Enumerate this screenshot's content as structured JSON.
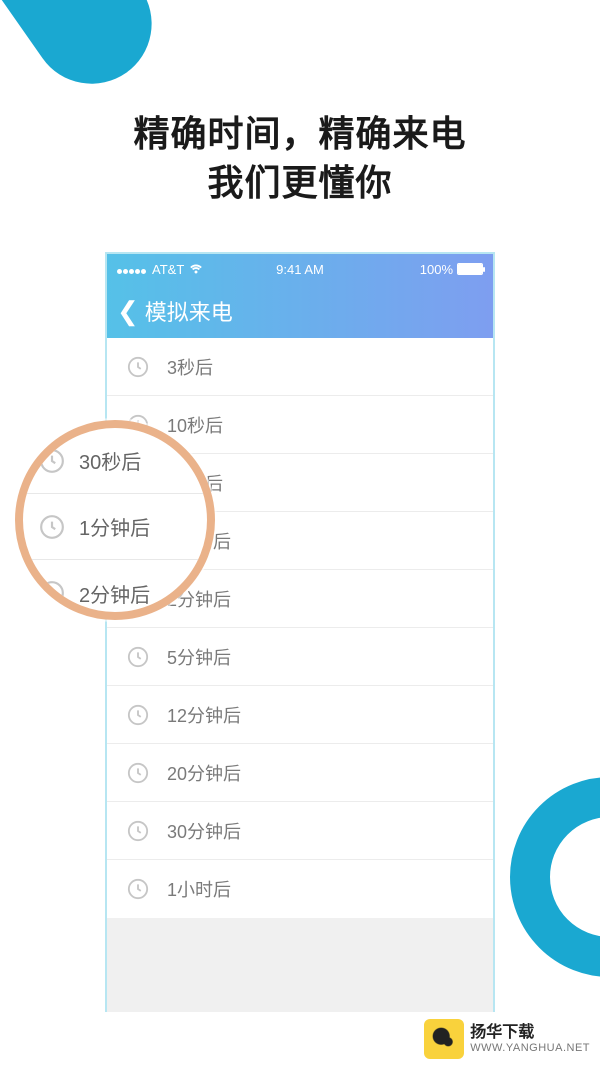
{
  "headline": {
    "line1": "精确时间，精确来电",
    "line2": "我们更懂你"
  },
  "status": {
    "carrier": "AT&T",
    "time": "9:41 AM",
    "battery": "100%"
  },
  "nav": {
    "title": "模拟来电"
  },
  "list": {
    "items": [
      {
        "label": "3秒后"
      },
      {
        "label": "10秒后"
      },
      {
        "label": "30秒后"
      },
      {
        "label": "1分钟后"
      },
      {
        "label": "2分钟后"
      },
      {
        "label": "5分钟后"
      },
      {
        "label": "12分钟后"
      },
      {
        "label": "20分钟后"
      },
      {
        "label": "30分钟后"
      },
      {
        "label": "1小时后"
      }
    ]
  },
  "magnifier": {
    "items": [
      {
        "label": "30秒后"
      },
      {
        "label": "1分钟后"
      },
      {
        "label": "2分钟后"
      }
    ]
  },
  "watermark": {
    "brand": "扬华下载",
    "url": "WWW.YANGHUA.NET"
  }
}
